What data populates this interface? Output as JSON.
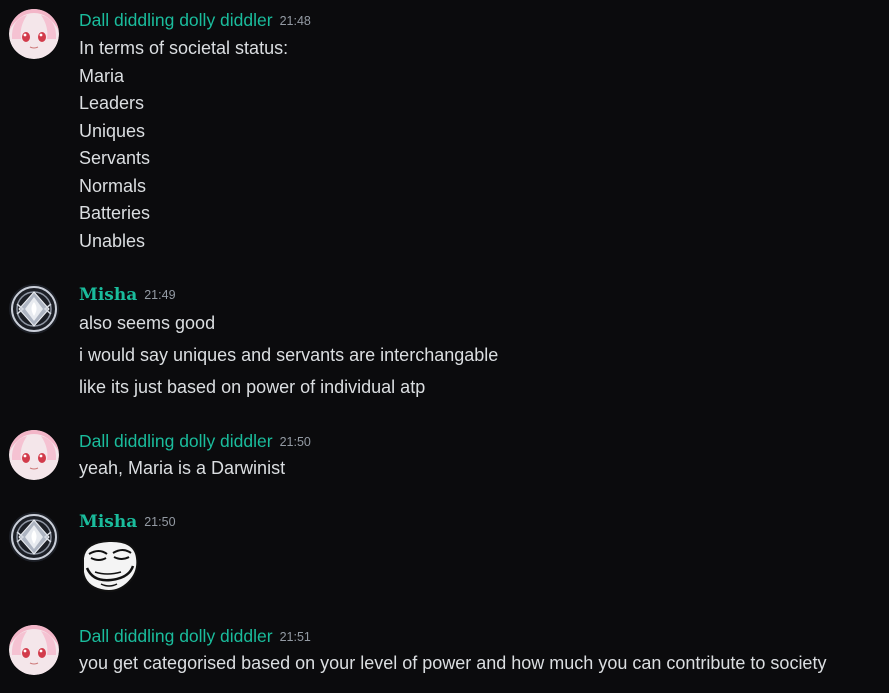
{
  "messages": [
    {
      "author": "Dall diddling dolly diddler",
      "time": "21:48",
      "lines": [
        "In terms of societal status:",
        "Maria",
        "Leaders",
        "Uniques",
        "Servants",
        "Normals",
        "Batteries",
        "Unables"
      ]
    },
    {
      "author": "Misha",
      "time": "21:49",
      "lines": [
        "also seems good",
        "i would say uniques and servants are interchangable",
        "like its just based on power of individual atp"
      ]
    },
    {
      "author": "Dall diddling dolly diddler",
      "time": "21:50",
      "lines": [
        "yeah, Maria is a Darwinist"
      ]
    },
    {
      "author": "Misha",
      "time": "21:50",
      "emoji": "troll-face-emoji"
    },
    {
      "author": "Dall diddling dolly diddler",
      "time": "21:51",
      "lines": [
        "you get categorised based on your level of power and how much you can contribute to society"
      ]
    }
  ],
  "colors": {
    "background": "#0b0b0d",
    "username": "#1abc9c",
    "text": "#dbdee1",
    "timestamp": "#949ba4"
  }
}
